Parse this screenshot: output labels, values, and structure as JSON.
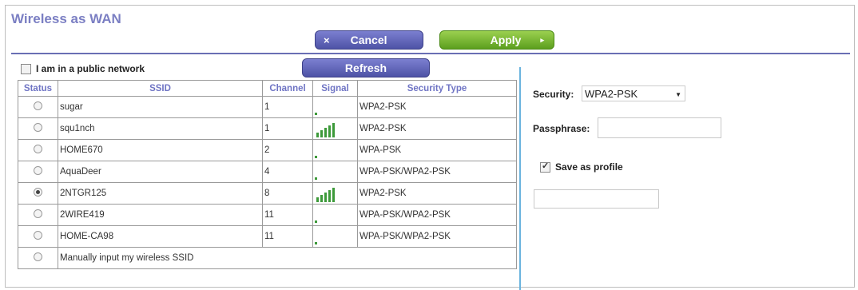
{
  "page": {
    "title": "Wireless as WAN"
  },
  "buttons": {
    "cancel": "Cancel",
    "cancel_icon": "×",
    "apply": "Apply",
    "apply_icon": "▸",
    "refresh": "Refresh"
  },
  "public_network": {
    "label": "I am in a public network",
    "checked": false
  },
  "table": {
    "headers": {
      "status": "Status",
      "ssid": "SSID",
      "channel": "Channel",
      "signal": "Signal",
      "security": "Security Type"
    },
    "rows": [
      {
        "ssid": "sugar",
        "channel": "1",
        "signal_bars": 0,
        "security": "WPA2-PSK",
        "selected": false
      },
      {
        "ssid": "squ1nch",
        "channel": "1",
        "signal_bars": 5,
        "security": "WPA2-PSK",
        "selected": false
      },
      {
        "ssid": "HOME670",
        "channel": "2",
        "signal_bars": 0,
        "security": "WPA-PSK",
        "selected": false
      },
      {
        "ssid": "AquaDeer",
        "channel": "4",
        "signal_bars": 0,
        "security": "WPA-PSK/WPA2-PSK",
        "selected": false
      },
      {
        "ssid": "2NTGR125",
        "channel": "8",
        "signal_bars": 5,
        "security": "WPA2-PSK",
        "selected": true
      },
      {
        "ssid": "2WIRE419",
        "channel": "11",
        "signal_bars": 0,
        "security": "WPA-PSK/WPA2-PSK",
        "selected": false
      },
      {
        "ssid": "HOME-CA98",
        "channel": "11",
        "signal_bars": 0,
        "security": "WPA-PSK/WPA2-PSK",
        "selected": false
      }
    ],
    "manual_label": "Manually input my wireless SSID"
  },
  "security": {
    "label": "Security:",
    "value": "WPA2-PSK",
    "caret": "▼"
  },
  "passphrase": {
    "label": "Passphrase:",
    "value": ""
  },
  "save_profile": {
    "label": "Save as profile",
    "checked": true
  },
  "profile_name": {
    "value": ""
  },
  "colors": {
    "title": "#7b7fc3",
    "accent_purple": "#6a6fb4",
    "apply_green": "#6fb22a",
    "signal_green": "#3d9a3a",
    "divider_blue": "#6bb4de"
  }
}
